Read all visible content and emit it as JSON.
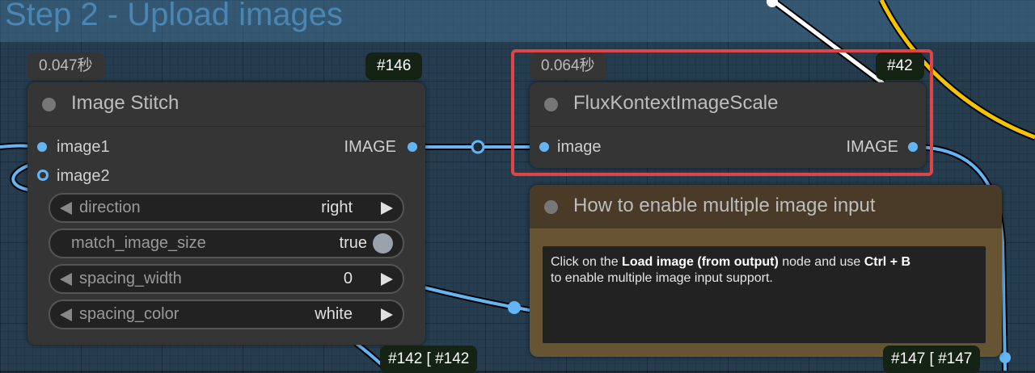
{
  "canvas": {
    "group_title": "Step 2 - Upload images",
    "colors": {
      "background": "#1e2a33",
      "group": "#386e96",
      "node": "#353535",
      "note": "#665433",
      "link_image": "#64b5f6",
      "link_yellow": "#f5c400",
      "link_white": "#ffffff",
      "highlight": "#e04444"
    }
  },
  "image_stitch": {
    "time": "0.047秒",
    "id": "#146",
    "title": "Image Stitch",
    "inputs": [
      "image1",
      "image2"
    ],
    "output": "IMAGE",
    "widgets": {
      "direction": {
        "label": "direction",
        "value": "right"
      },
      "match_image_size": {
        "label": "match_image_size",
        "value": "true"
      },
      "spacing_width": {
        "label": "spacing_width",
        "value": "0"
      },
      "spacing_color": {
        "label": "spacing_color",
        "value": "white"
      }
    }
  },
  "flux_scale": {
    "time": "0.064秒",
    "id": "#42",
    "title": "FluxKontextImageScale",
    "input": "image",
    "output": "IMAGE"
  },
  "note": {
    "title": "How to enable multiple image input",
    "line1_pre": "Click on the ",
    "line1_bold": "Load image (from output)",
    "line1_mid": " node and use ",
    "line1_key": "Ctrl + B",
    "line2": "to enable multiple image input support."
  },
  "badges": {
    "left": {
      "a": "#142 [",
      "b": "#142"
    },
    "right": {
      "a": "#147 [",
      "b": "#147"
    }
  }
}
